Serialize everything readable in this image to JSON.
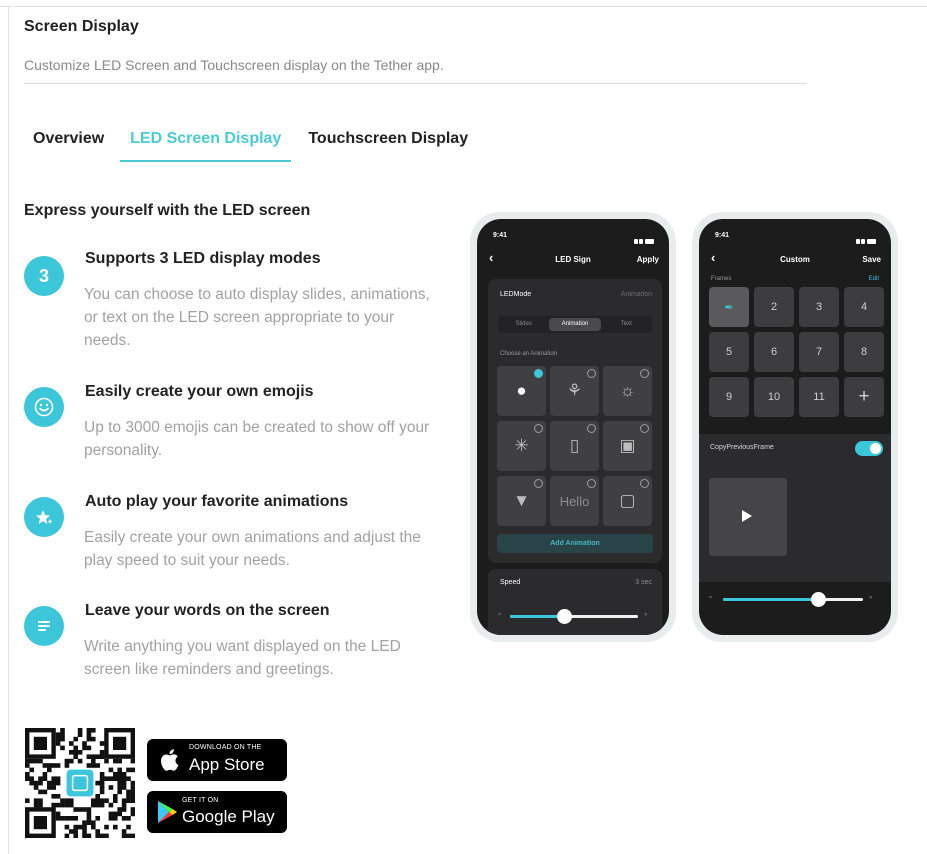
{
  "section": {
    "title": "Screen Display",
    "subtitle": "Customize LED Screen and Touchscreen display on the Tether app."
  },
  "tabs": [
    {
      "label": "Overview",
      "active": false
    },
    {
      "label": "LED Screen Display",
      "active": true
    },
    {
      "label": "Touchscreen Display",
      "active": false
    }
  ],
  "headline": "Express yourself with the LED screen",
  "features": [
    {
      "icon": "number-3-icon",
      "icon_text": "3",
      "title": "Supports 3 LED display modes",
      "desc": "You can choose to auto display slides, animations, or text on the LED screen appropriate to your needs."
    },
    {
      "icon": "smiley-face-icon",
      "title": "Easily create your own emojis",
      "desc": "Up to 3000 emojis can be created to show off your personality."
    },
    {
      "icon": "star-sparkle-icon",
      "title": "Auto play your favorite animations",
      "desc": "Easily create your own animations and adjust the play speed to suit your needs."
    },
    {
      "icon": "text-lines-icon",
      "title": "Leave your words on the screen",
      "desc": "Write anything you want displayed on the LED screen like reminders and greetings."
    }
  ],
  "phone1": {
    "time": "9:41",
    "title": "LED Sign",
    "action": "Apply",
    "mode_label": "LEDMode",
    "mode_value": "Animation",
    "segments": [
      "Slides",
      "Animation",
      "Text"
    ],
    "active_segment": "Animation",
    "choose_label": "Choose an Animation",
    "hello_label": "Hello",
    "add_button": "Add Animation",
    "speed_label": "Speed",
    "speed_value": "3 sec",
    "speed_level": 0.42
  },
  "phone2": {
    "time": "9:41",
    "title": "Custom",
    "action": "Save",
    "frames_label": "Frames",
    "edit_label": "Edit",
    "frames": [
      "",
      "2",
      "3",
      "4",
      "5",
      "6",
      "7",
      "8",
      "9",
      "10",
      "11",
      "+"
    ],
    "copy_label": "CopyPreviousFrame",
    "copy_enabled": true,
    "speed_level": 0.68
  },
  "downloads": {
    "appstore_small": "DOWNLOAD ON THE",
    "appstore_big": "App Store",
    "gplay_small": "GET IT ON",
    "gplay_big": "Google Play"
  },
  "colors": {
    "accent": "#3cc6d9",
    "tab_active": "#4acbd6"
  }
}
